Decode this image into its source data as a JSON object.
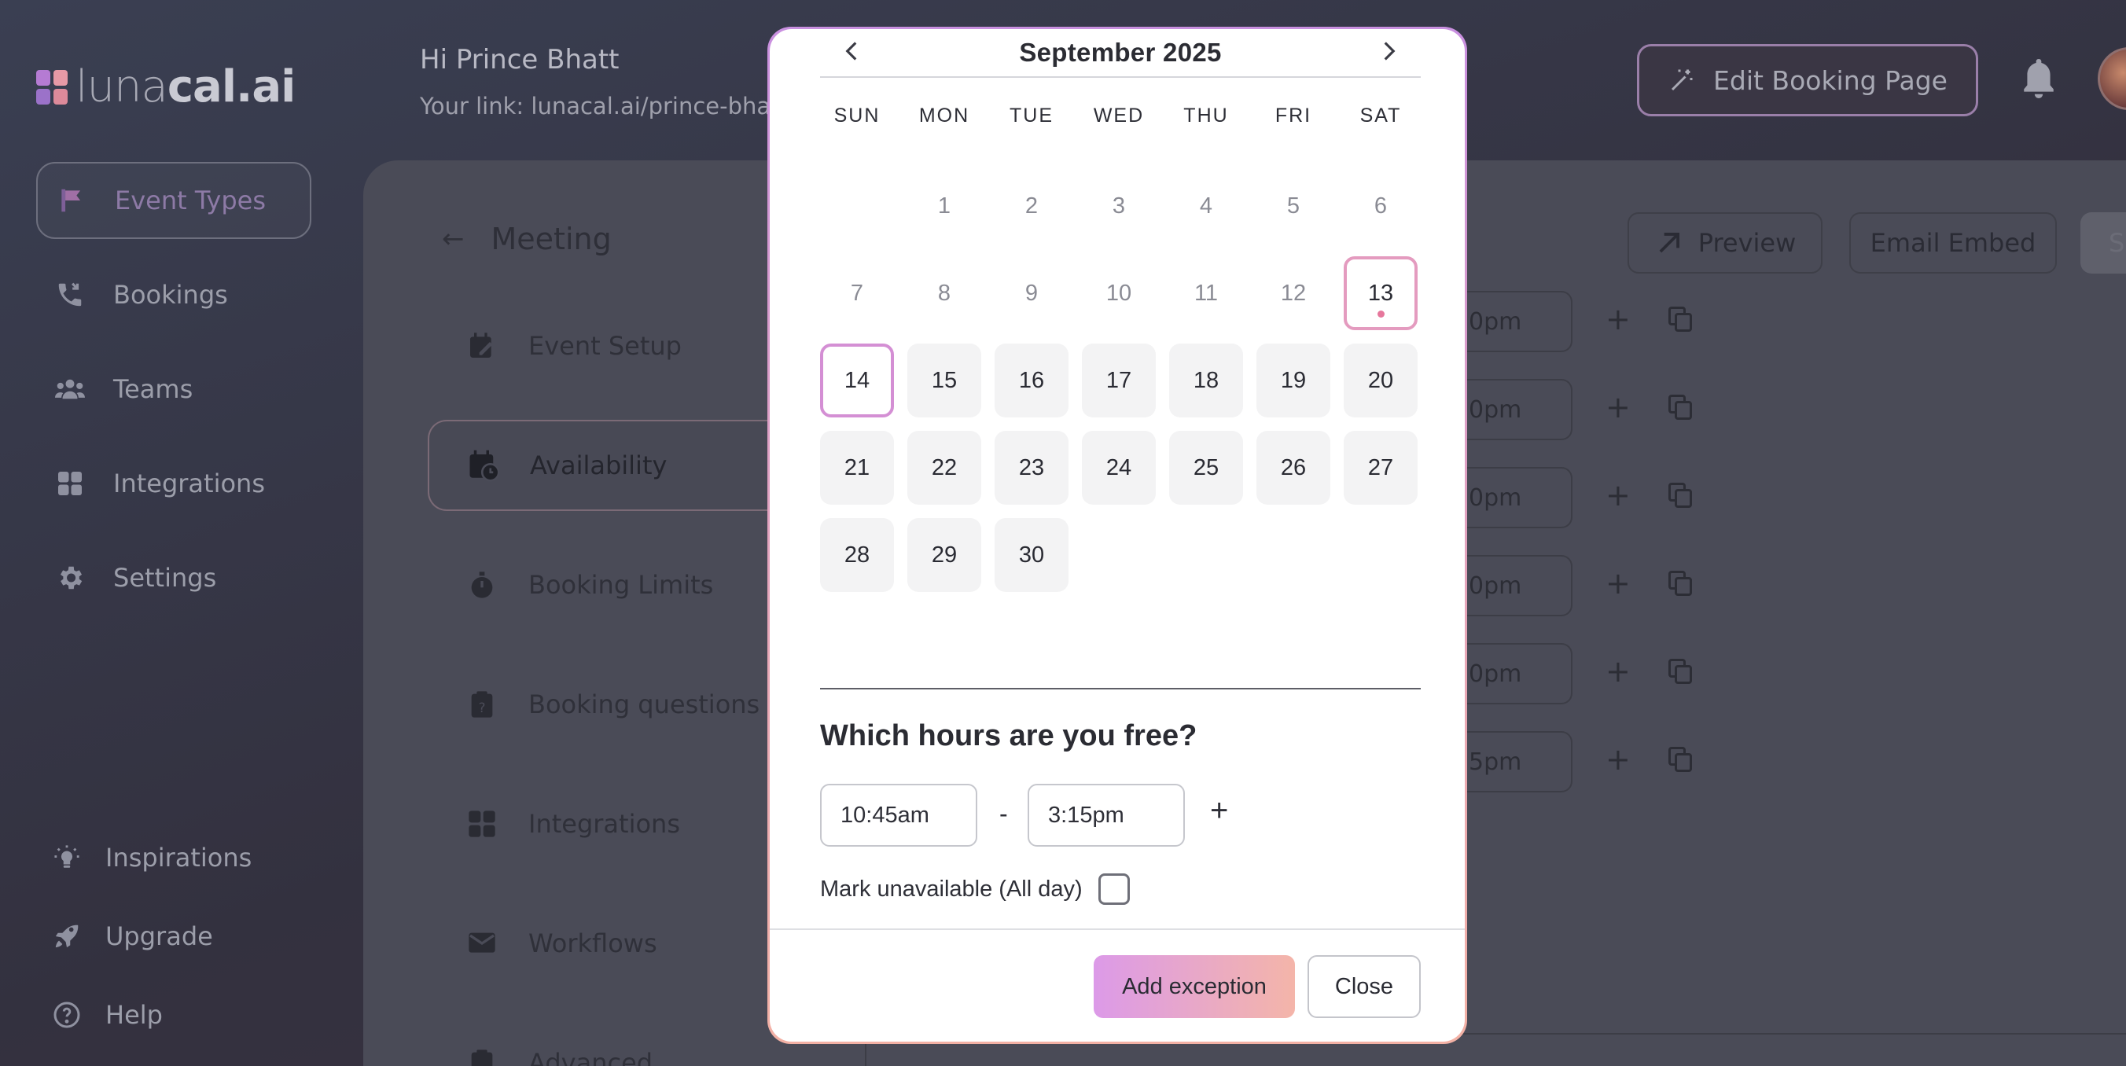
{
  "logo": {
    "prefix": "luna",
    "bold": "cal.ai"
  },
  "header": {
    "greeting": "Hi Prince Bhatt",
    "link": "Your link: lunacal.ai/prince-bhatt-",
    "edit_button": "Edit Booking Page"
  },
  "sidebar": {
    "items": [
      {
        "label": "Event Types",
        "icon": "flag-icon"
      },
      {
        "label": "Bookings",
        "icon": "phone-icon"
      },
      {
        "label": "Teams",
        "icon": "people-icon"
      },
      {
        "label": "Integrations",
        "icon": "grid-icon"
      },
      {
        "label": "Settings",
        "icon": "gear-icon"
      }
    ],
    "bottom": [
      {
        "label": "Inspirations",
        "icon": "bulb-icon"
      },
      {
        "label": "Upgrade",
        "icon": "rocket-icon"
      },
      {
        "label": "Help",
        "icon": "help-icon"
      }
    ]
  },
  "event": {
    "title": "Meeting",
    "menu": [
      {
        "label": "Event Setup"
      },
      {
        "label": "Availability"
      },
      {
        "label": "Booking Limits"
      },
      {
        "label": "Booking questions"
      },
      {
        "label": "Integrations"
      },
      {
        "label": "Workflows"
      },
      {
        "label": "Advanced"
      }
    ],
    "toolbar": {
      "preview": "Preview",
      "email_embed": "Email Embed",
      "save": "Sa"
    },
    "rows": [
      "0pm",
      "0pm",
      "0pm",
      "0pm",
      "0pm",
      "5pm"
    ]
  },
  "modal": {
    "month": "September 2025",
    "prev_icon": "chevron-left-icon",
    "next_icon": "chevron-right-icon",
    "weekdays": [
      "SUN",
      "MON",
      "TUE",
      "WED",
      "THU",
      "FRI",
      "SAT"
    ],
    "days": [
      "",
      "1",
      "2",
      "3",
      "4",
      "5",
      "6",
      "7",
      "8",
      "9",
      "10",
      "11",
      "12",
      "13",
      "14",
      "15",
      "16",
      "17",
      "18",
      "19",
      "20",
      "21",
      "22",
      "23",
      "24",
      "25",
      "26",
      "27",
      "28",
      "29",
      "30"
    ],
    "today": "13",
    "selected": "14",
    "hours_title": "Which hours are you free?",
    "start_time": "10:45am",
    "end_time": "3:15pm",
    "dash": "-",
    "add_range": "+",
    "unavailable_label": "Mark unavailable (All day)",
    "unavailable_checked": false,
    "add_exception": "Add exception",
    "close": "Close"
  },
  "colors": {
    "accent_start": "#dc9ae8",
    "accent_end": "#f4b5a9",
    "today_border": "#e49bbf",
    "selected_border": "#d48fd4"
  }
}
